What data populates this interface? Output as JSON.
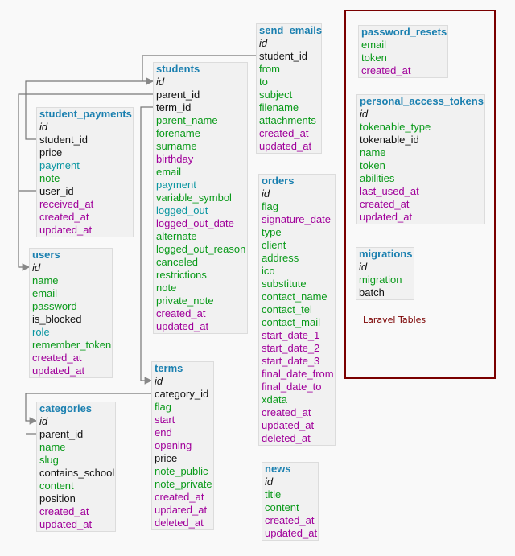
{
  "frame_label": "Laravel Tables",
  "colors": {
    "title": "#1b80b0",
    "integer": "#111111",
    "string": "#0a9a1a",
    "boolean": "#0895a0",
    "date": "#a0009a",
    "frame": "#7a0000",
    "relation_line": "#777777"
  },
  "tables": [
    {
      "name": "send_emails",
      "fields": [
        [
          "id",
          "i"
        ],
        [
          "student_id",
          "k"
        ],
        [
          "from",
          "g"
        ],
        [
          "to",
          "g"
        ],
        [
          "subject",
          "g"
        ],
        [
          "filename",
          "g"
        ],
        [
          "attachments",
          "g"
        ],
        [
          "created_at",
          "p"
        ],
        [
          "updated_at",
          "p"
        ]
      ]
    },
    {
      "name": "students",
      "fields": [
        [
          "id",
          "i"
        ],
        [
          "parent_id",
          "k"
        ],
        [
          "term_id",
          "k"
        ],
        [
          "parent_name",
          "g"
        ],
        [
          "forename",
          "g"
        ],
        [
          "surname",
          "g"
        ],
        [
          "birthday",
          "p"
        ],
        [
          "email",
          "g"
        ],
        [
          "payment",
          "t"
        ],
        [
          "variable_symbol",
          "g"
        ],
        [
          "logged_out",
          "t"
        ],
        [
          "logged_out_date",
          "p"
        ],
        [
          "alternate",
          "g"
        ],
        [
          "logged_out_reason",
          "g"
        ],
        [
          "canceled",
          "g"
        ],
        [
          "restrictions",
          "g"
        ],
        [
          "note",
          "g"
        ],
        [
          "private_note",
          "g"
        ],
        [
          "created_at",
          "p"
        ],
        [
          "updated_at",
          "p"
        ]
      ]
    },
    {
      "name": "student_payments",
      "fields": [
        [
          "id",
          "i"
        ],
        [
          "student_id",
          "k"
        ],
        [
          "price",
          "k"
        ],
        [
          "payment",
          "t"
        ],
        [
          "note",
          "g"
        ],
        [
          "user_id",
          "k"
        ],
        [
          "received_at",
          "p"
        ],
        [
          "created_at",
          "p"
        ],
        [
          "updated_at",
          "p"
        ]
      ]
    },
    {
      "name": "users",
      "fields": [
        [
          "id",
          "i"
        ],
        [
          "name",
          "g"
        ],
        [
          "email",
          "g"
        ],
        [
          "password",
          "g"
        ],
        [
          "is_blocked",
          "k"
        ],
        [
          "role",
          "t"
        ],
        [
          "remember_token",
          "g"
        ],
        [
          "created_at",
          "p"
        ],
        [
          "updated_at",
          "p"
        ]
      ]
    },
    {
      "name": "categories",
      "fields": [
        [
          "id",
          "i"
        ],
        [
          "parent_id",
          "k"
        ],
        [
          "name",
          "g"
        ],
        [
          "slug",
          "g"
        ],
        [
          "contains_school",
          "k"
        ],
        [
          "content",
          "g"
        ],
        [
          "position",
          "k"
        ],
        [
          "created_at",
          "p"
        ],
        [
          "updated_at",
          "p"
        ]
      ]
    },
    {
      "name": "terms",
      "fields": [
        [
          "id",
          "i"
        ],
        [
          "category_id",
          "k"
        ],
        [
          "flag",
          "g"
        ],
        [
          "start",
          "p"
        ],
        [
          "end",
          "p"
        ],
        [
          "opening",
          "p"
        ],
        [
          "price",
          "k"
        ],
        [
          "note_public",
          "g"
        ],
        [
          "note_private",
          "g"
        ],
        [
          "created_at",
          "p"
        ],
        [
          "updated_at",
          "p"
        ],
        [
          "deleted_at",
          "p"
        ]
      ]
    },
    {
      "name": "orders",
      "fields": [
        [
          "id",
          "i"
        ],
        [
          "flag",
          "g"
        ],
        [
          "signature_date",
          "p"
        ],
        [
          "type",
          "g"
        ],
        [
          "client",
          "g"
        ],
        [
          "address",
          "g"
        ],
        [
          "ico",
          "g"
        ],
        [
          "substitute",
          "g"
        ],
        [
          "contact_name",
          "g"
        ],
        [
          "contact_tel",
          "g"
        ],
        [
          "contact_mail",
          "g"
        ],
        [
          "start_date_1",
          "p"
        ],
        [
          "start_date_2",
          "p"
        ],
        [
          "start_date_3",
          "p"
        ],
        [
          "final_date_from",
          "p"
        ],
        [
          "final_date_to",
          "p"
        ],
        [
          "xdata",
          "g"
        ],
        [
          "created_at",
          "p"
        ],
        [
          "updated_at",
          "p"
        ],
        [
          "deleted_at",
          "p"
        ]
      ]
    },
    {
      "name": "news",
      "fields": [
        [
          "id",
          "i"
        ],
        [
          "title",
          "g"
        ],
        [
          "content",
          "g"
        ],
        [
          "created_at",
          "p"
        ],
        [
          "updated_at",
          "p"
        ]
      ]
    },
    {
      "name": "password_resets",
      "fields": [
        [
          "email",
          "g"
        ],
        [
          "token",
          "g"
        ],
        [
          "created_at",
          "p"
        ]
      ]
    },
    {
      "name": "personal_access_tokens",
      "fields": [
        [
          "id",
          "i"
        ],
        [
          "tokenable_type",
          "g"
        ],
        [
          "tokenable_id",
          "k"
        ],
        [
          "name",
          "g"
        ],
        [
          "token",
          "g"
        ],
        [
          "abilities",
          "g"
        ],
        [
          "last_used_at",
          "p"
        ],
        [
          "created_at",
          "p"
        ],
        [
          "updated_at",
          "p"
        ]
      ]
    },
    {
      "name": "migrations",
      "fields": [
        [
          "id",
          "i"
        ],
        [
          "migration",
          "g"
        ],
        [
          "batch",
          "k"
        ]
      ]
    }
  ]
}
